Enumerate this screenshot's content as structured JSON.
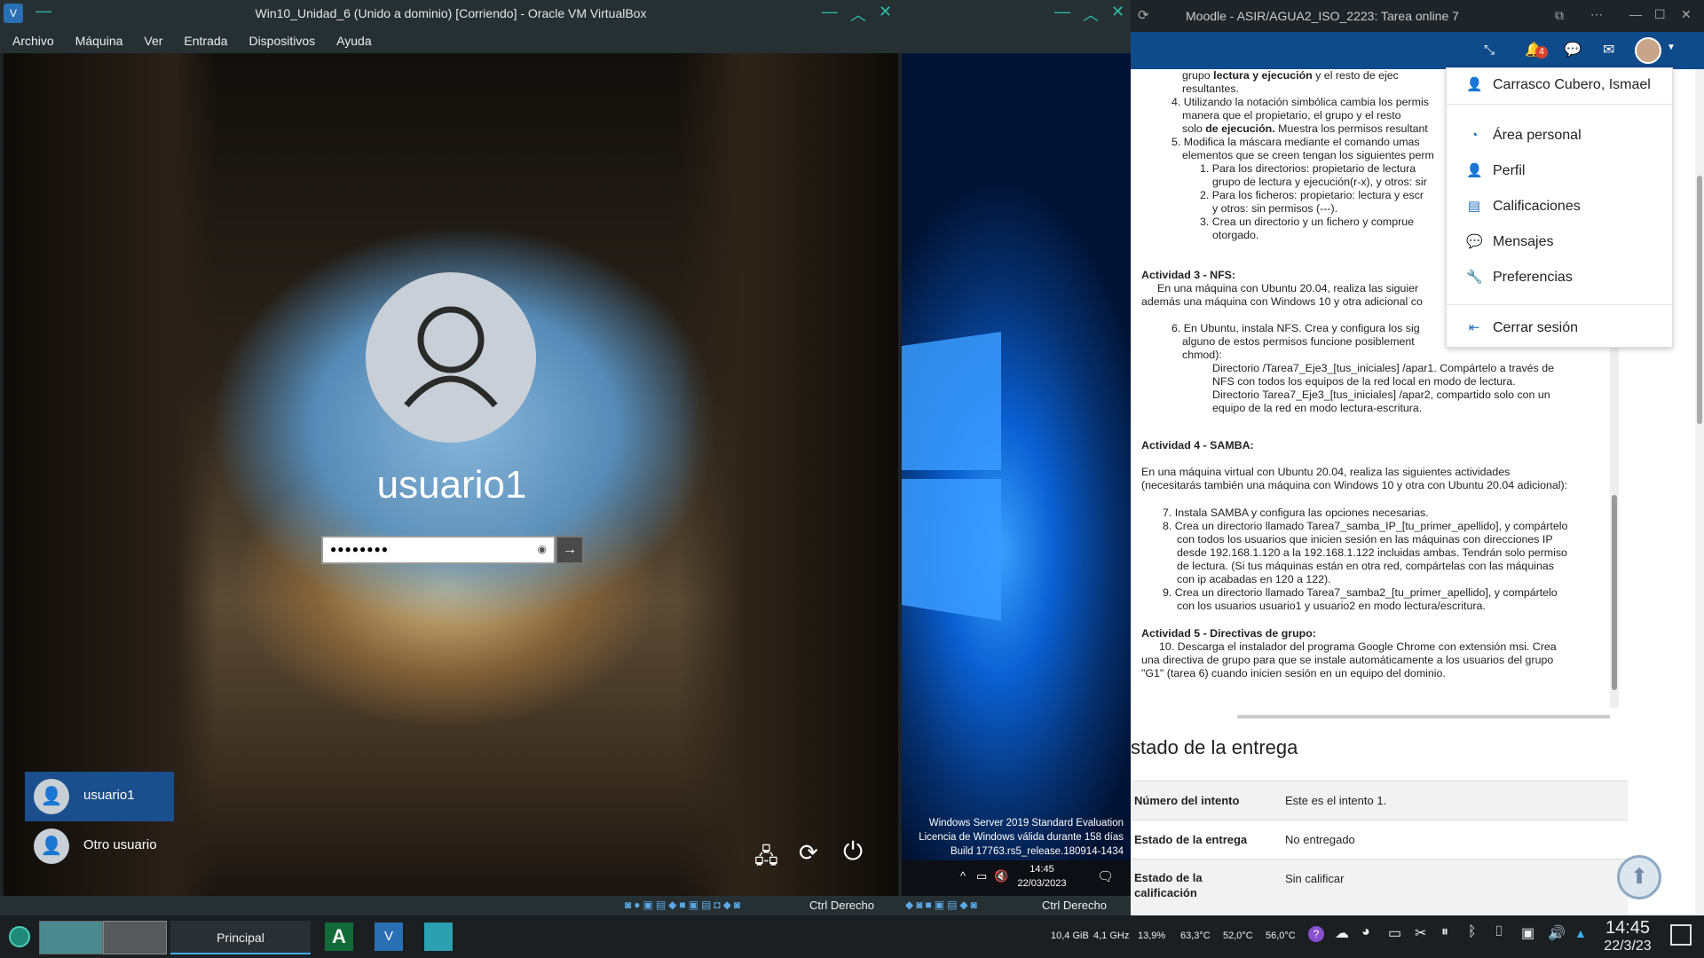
{
  "vm1": {
    "title": "Win10_Unidad_6 (Unido a dominio) [Corriendo] - Oracle VM VirtualBox",
    "menu": [
      "Archivo",
      "Máquina",
      "Ver",
      "Entrada",
      "Dispositivos",
      "Ayuda"
    ],
    "login": {
      "username": "usuario1",
      "password_mask": "●●●●●●●●",
      "users": [
        "usuario1",
        "Otro usuario"
      ]
    },
    "status_text": "Ctrl Derecho"
  },
  "vm2": {
    "watermark": [
      "Windows Server 2019 Standard Evaluation",
      "Licencia de Windows válida durante 158 días",
      "Build 17763.rs5_release.180914-1434"
    ],
    "clock_time": "14:45",
    "clock_date": "22/03/2023",
    "status_text": "Ctrl Derecho"
  },
  "browser": {
    "title": "Moodle - ASIR/AGUA2_ISO_2223: Tarea online 7",
    "notification_count": "4",
    "dropdown": {
      "user_name": "Carrasco Cubero, Ismael",
      "items": [
        "Área personal",
        "Perfil",
        "Calificaciones",
        "Mensajes",
        "Preferencias"
      ],
      "logout": "Cerrar sesión"
    },
    "doc": {
      "p1_pre": "grupo ",
      "p1_bold": "lectura y ejecución",
      "p1_post": " y el resto de ejec",
      "p1b": "resultantes.",
      "i4_a": "4. Utilizando la notación simbólica cambia los permis",
      "i4_b": "manera que el propietario, el grupo y el resto",
      "i4_c_pre": "solo ",
      "i4_c_bold": "de ejecución.",
      "i4_c_post": " Muestra los permisos resultant",
      "i5_a": "5. Modifica la máscara mediante el comando umas",
      "i5_b": "elementos que se creen tengan los siguientes perm",
      "i5_1a": "1. Para los directorios: propietario de lectura",
      "i5_1b": "grupo de lectura y ejecución(r-x), y otros: sir",
      "i5_2a": "2. Para los ficheros: propietario: lectura y escr",
      "i5_2b": "y otros: sin permisos (---).",
      "i5_3a": "3. Crea un directorio y un fichero y comprue",
      "i5_3b": "otorgado.",
      "a3_title": "Actividad 3 - NFS:",
      "a3_a": "En una máquina con Ubuntu 20.04, realiza las siguier",
      "a3_b": "además una máquina con Windows 10 y otra adicional co",
      "i6_a": "6. En Ubuntu, instala NFS. Crea y configura los sig",
      "i6_b": "alguno de estos permisos funcione posiblement",
      "i6_c": "chmod):",
      "i6_d1": "Directorio /Tarea7_Eje3_[tus_iniciales] /apar1. Compártelo a través de",
      "i6_d2": "NFS con todos los equipos de la red local en modo de lectura.",
      "i6_e1": "Directorio Tarea7_Eje3_[tus_iniciales] /apar2, compartido solo con un",
      "i6_e2": "equipo de la red en modo lectura-escritura.",
      "a4_title": "Actividad 4 - SAMBA:",
      "a4_a": "En una máquina virtual con Ubuntu 20.04, realiza las siguientes actividades",
      "a4_b": "(necesitarás también una máquina con Windows 10 y otra con Ubuntu 20.04 adicional):",
      "i7": "7. Instala SAMBA y configura las opciones necesarias.",
      "i8_a": "8. Crea un directorio llamado Tarea7_samba_IP_[tu_primer_apellido], y compártelo",
      "i8_b": "con todos los usuarios que inicien sesión en las máquinas con direcciones IP",
      "i8_c": "desde 192.168.1.120 a la 192.168.1.122 incluidas ambas. Tendrán solo permiso",
      "i8_d": "de lectura. (Si tus máquinas están en otra red, compártelas con las máquinas",
      "i8_e": "con ip acabadas en 120 a 122).",
      "i9_a": "9. Crea un directorio llamado Tarea7_samba2_[tu_primer_apellido], y compártelo",
      "i9_b": "con los usuarios usuario1 y usuario2 en modo lectura/escritura.",
      "a5_title": "Actividad 5 - Directivas de grupo:",
      "i10_a": "10. Descarga el instalador del programa Google Chrome con extensión msi. Crea",
      "i10_b": "una directiva de grupo para que se instale automáticamente a los usuarios del grupo",
      "i10_c": "\"G1\" (tarea 6)  cuando inicien sesión en un equipo del dominio."
    },
    "submission_heading": "stado de la entrega",
    "submission_rows": [
      {
        "label": "Número del intento",
        "value": "Este es el intento 1."
      },
      {
        "label": "Estado de la entrega",
        "value": "No entregado"
      },
      {
        "label": "Estado de la calificación",
        "value": "Sin calificar"
      }
    ]
  },
  "taskbar": {
    "task_label": "Principal",
    "stats": [
      "10,4 GiB",
      "4,1 GHz",
      "13,9%",
      "63,3°C",
      "52,0°C",
      "56,0°C"
    ],
    "time": "14:45",
    "date": "22/3/23"
  }
}
